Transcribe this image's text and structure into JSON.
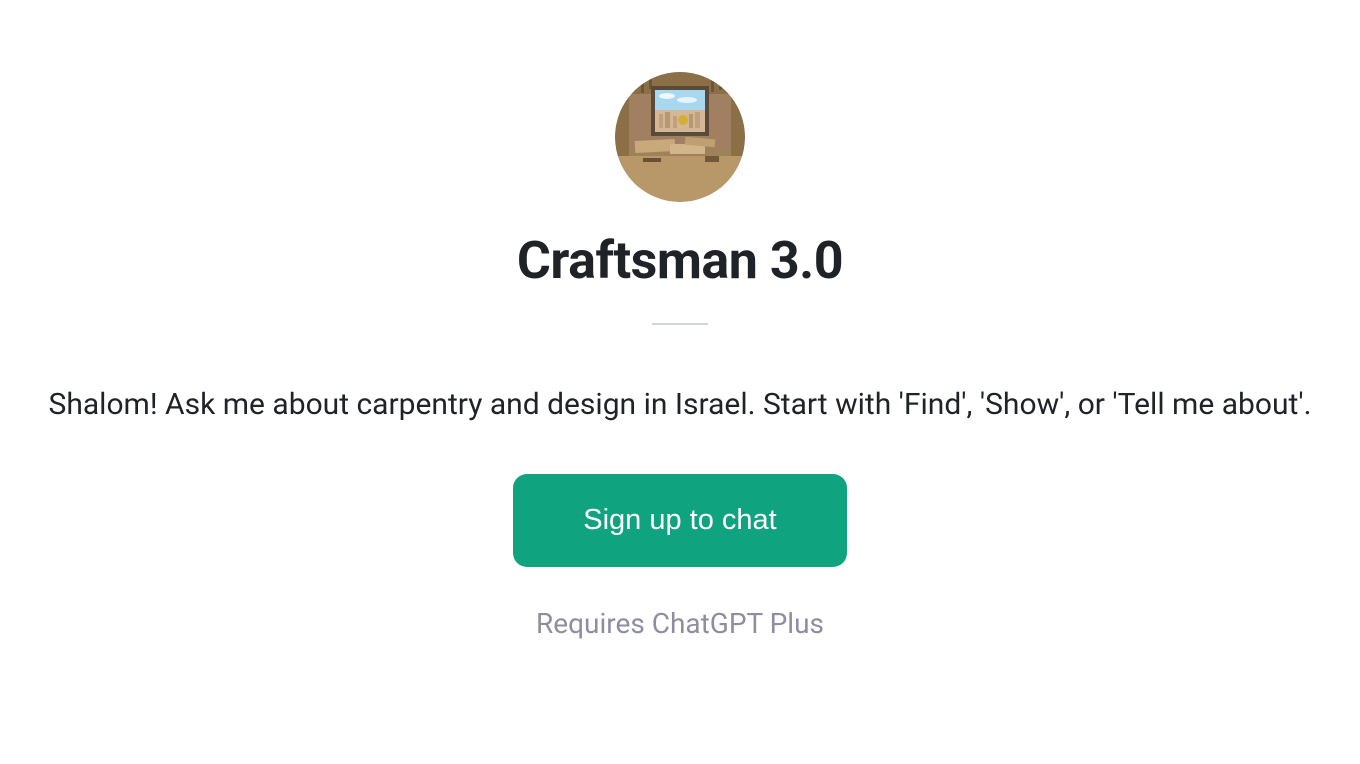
{
  "main": {
    "title": "Craftsman 3.0",
    "description": "Shalom! Ask me about carpentry and design in Israel. Start with 'Find', 'Show', or 'Tell me about'.",
    "signup_label": "Sign up to chat",
    "requires_label": "Requires ChatGPT Plus"
  }
}
